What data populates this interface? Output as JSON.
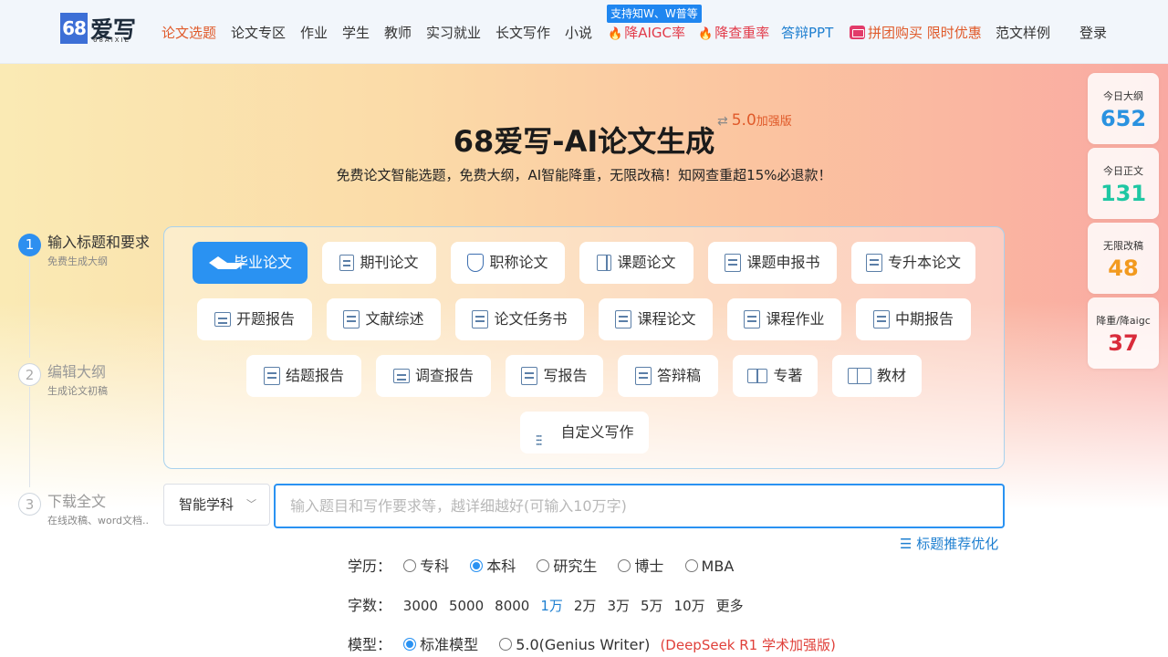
{
  "logo": {
    "num": "68",
    "cn": "爱写",
    "sub": "68AIXIE"
  },
  "nav": {
    "items": [
      "论文选题",
      "论文专区",
      "作业",
      "学生",
      "教师",
      "实习就业",
      "长文写作",
      "小说"
    ],
    "aigc": "降AIGC率",
    "aigc_badge": "支持知W、W普等",
    "plagiarism": "降查重率",
    "ppt": "答辩PPT",
    "group_buy": "拼团购买 限时优惠",
    "samples": "范文样例",
    "login": "登录"
  },
  "hero": {
    "title": "68爱写-AI论文生成",
    "version": "5.0",
    "version_tag": "加强版",
    "subtitle": "免费论文智能选题，免费大纲，AI智能降重，无限改稿！知网查重超15%必退款！"
  },
  "stats": [
    {
      "label": "今日大纲",
      "value": "652",
      "color": "#2a92e0"
    },
    {
      "label": "今日正文",
      "value": "131",
      "color": "#1fc7a3"
    },
    {
      "label": "无限改稿",
      "value": "48",
      "color": "#f29a1f"
    },
    {
      "label": "降重/降aigc",
      "value": "37",
      "color": "#d92b3a"
    }
  ],
  "steps": [
    {
      "num": "1",
      "title": "输入标题和要求",
      "sub": "免费生成大纲"
    },
    {
      "num": "2",
      "title": "编辑大纲",
      "sub": "生成论文初稿"
    },
    {
      "num": "3",
      "title": "下载全文",
      "sub": "在线改稿、word文档.."
    }
  ],
  "types": [
    "毕业论文",
    "期刊论文",
    "职称论文",
    "课题论文",
    "课题申报书",
    "专升本论文",
    "开题报告",
    "文献综述",
    "论文任务书",
    "课程论文",
    "课程作业",
    "中期报告",
    "结题报告",
    "调查报告",
    "写报告",
    "答辩稿",
    "专著",
    "教材",
    "自定义写作"
  ],
  "form": {
    "subject": "智能学科",
    "prompt_placeholder": "输入题目和写作要求等，越详细越好(可输入10万字)",
    "suggest": "标题推荐优化",
    "edu_label": "学历：",
    "edu": [
      "专科",
      "本科",
      "研究生",
      "博士",
      "MBA"
    ],
    "edu_selected": "本科",
    "wc_label": "字数：",
    "wc": [
      "3000",
      "5000",
      "8000",
      "1万",
      "2万",
      "3万",
      "5万",
      "10万",
      "更多"
    ],
    "wc_selected": "1万",
    "model_label": "模型：",
    "model_std": "标准模型",
    "model_genius": "5.0(Genius Writer)",
    "model_note": "(DeepSeek R1 学术加强版)"
  }
}
